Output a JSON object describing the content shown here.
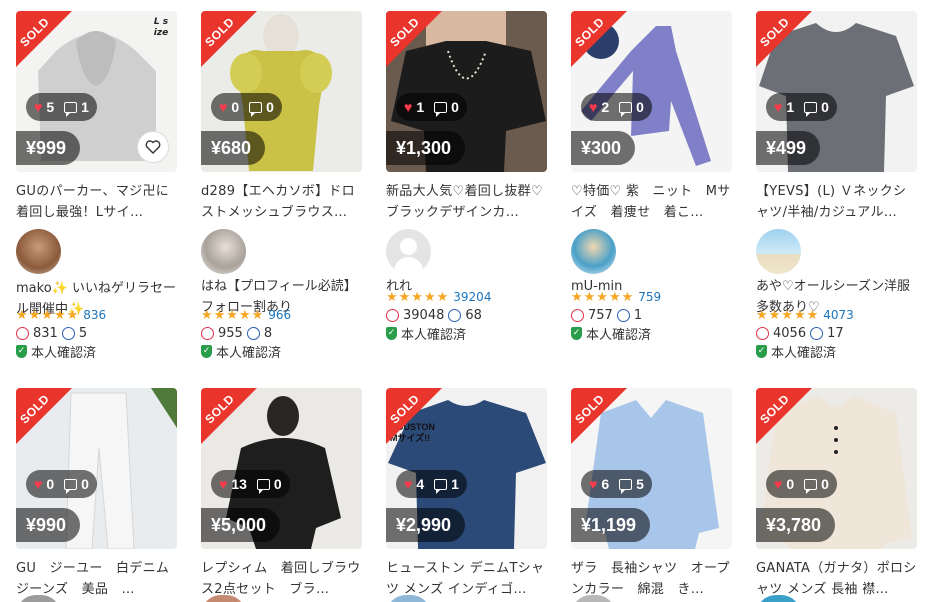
{
  "badge": "SOLD",
  "colors": {
    "sold": "#ea352d",
    "heart": "#ff3a4b",
    "link": "#1c75bc",
    "star": "#f5a623",
    "verified": "#2a9d4a"
  },
  "items": [
    {
      "price": "¥999",
      "likes": "5",
      "comments": "1",
      "title": "GUのパーカー、マジ卍に着回し最強！Lサイ…",
      "seller": "mako✨ いいねゲリラセール開催中✨",
      "rating": "836",
      "good": "831",
      "bad": "5",
      "verified": "本人確認済",
      "stamp": "L size",
      "icon": "heart-outline-icon"
    },
    {
      "price": "¥680",
      "likes": "0",
      "comments": "0",
      "title": "d289【エヘカソボ】ドロストメッシュブラウス…",
      "seller": "はね【プロフィール必読】フォロー割あり",
      "rating": "966",
      "good": "955",
      "bad": "8",
      "verified": "本人確認済"
    },
    {
      "price": "¥1,300",
      "likes": "1",
      "comments": "0",
      "title": "新品大人気♡着回し抜群♡ブラックデザインカ…",
      "seller": "れれ",
      "rating": "39204",
      "good": "39048",
      "bad": "68",
      "verified": "本人確認済"
    },
    {
      "price": "¥300",
      "likes": "2",
      "comments": "0",
      "title": "♡特価♡ 紫　ニット　Mサイズ　着痩せ　着こ…",
      "seller": "mU-min",
      "rating": "759",
      "good": "757",
      "bad": "1",
      "verified": "本人確認済"
    },
    {
      "price": "¥499",
      "likes": "1",
      "comments": "0",
      "title": "【YEVS】(L) Ｖネックシャツ/半袖/カジュアル…",
      "seller": "あや♡オールシーズン洋服多数あり♡",
      "rating": "4073",
      "good": "4056",
      "bad": "17",
      "verified": "本人確認済"
    },
    {
      "price": "¥990",
      "likes": "0",
      "comments": "0",
      "title": "GU　ジーユー　白デニム　ジーンズ　美品　…"
    },
    {
      "price": "¥5,000",
      "likes": "13",
      "comments": "0",
      "title": "レプシィム　着回しブラウス2点セット　ブラ…"
    },
    {
      "price": "¥2,990",
      "likes": "4",
      "comments": "1",
      "title": "ヒューストン デニムTシャツ メンズ インディゴ…",
      "stamp": "HOUSTON Mサイズ!!"
    },
    {
      "price": "¥1,199",
      "likes": "6",
      "comments": "5",
      "title": "ザラ　長袖シャツ　オープンカラー　綿混　き…"
    },
    {
      "price": "¥3,780",
      "likes": "0",
      "comments": "0",
      "title": "GANATA（ガナタ）ポロシャツ メンズ 長袖 襟…"
    }
  ]
}
